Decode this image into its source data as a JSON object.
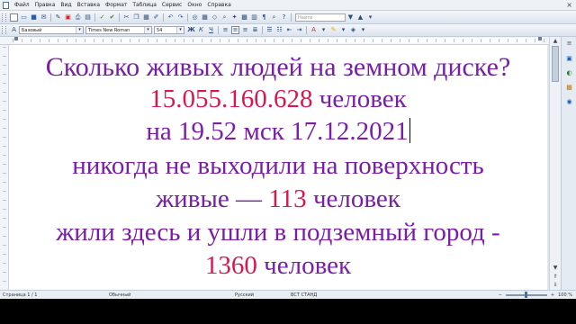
{
  "menu": {
    "items": [
      "Файл",
      "Правка",
      "Вид",
      "Вставка",
      "Формат",
      "Таблица",
      "Сервис",
      "Окно",
      "Справка"
    ],
    "close_glyph": "×"
  },
  "toolbar": {
    "find_placeholder": "Найти",
    "style_value": "Базовый",
    "font_value": "Times New Roman",
    "size_value": "54"
  },
  "document": {
    "line1": "Сколько живых людей на земном диске?",
    "line2_number": "15.055.160.628",
    "line2_suffix": " человек",
    "line3": "на 19.52 мск 17.12.2021",
    "line4": "никогда не выходили на поверхность",
    "line5_prefix": "живые — ",
    "line5_number": "113",
    "line5_suffix": " человек",
    "line6": "жили здесь и ушли в подземный город -",
    "line7_number": "1360",
    "line7_suffix": " человек",
    "colors": {
      "text": "#7a1ea8",
      "numbers": "#d9174f"
    }
  },
  "status": {
    "page": "Страница  1 / 1",
    "style": "Обычный",
    "language": "Русский",
    "mode": "ВСТ  СТАНД",
    "zoom": "100 %"
  }
}
